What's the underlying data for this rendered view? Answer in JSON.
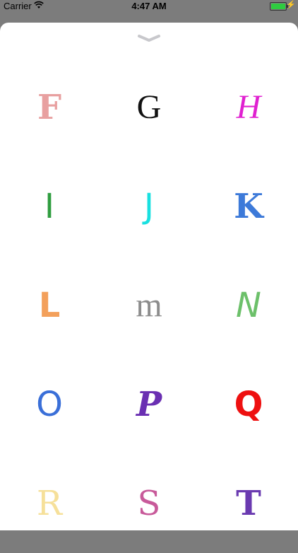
{
  "status": {
    "carrier": "Carrier",
    "time": "4:47 AM"
  },
  "sheet": {
    "close_icon": "chevron-down-icon"
  },
  "letters": [
    {
      "char": "F",
      "color": "#e8a0a0",
      "font": "serif",
      "weight": "bold",
      "style": "normal"
    },
    {
      "char": "G",
      "color": "#111111",
      "font": "cursive",
      "weight": "normal",
      "style": "normal"
    },
    {
      "char": "H",
      "color": "#e020d0",
      "font": "cursive",
      "weight": "normal",
      "style": "italic"
    },
    {
      "char": "I",
      "color": "#2f9d3f",
      "font": "sans",
      "weight": "normal",
      "style": "normal"
    },
    {
      "char": "J",
      "color": "#18e0e0",
      "font": "sans",
      "weight": "normal",
      "style": "normal"
    },
    {
      "char": "K",
      "color": "#3d7ad9",
      "font": "serif",
      "weight": "bold",
      "style": "normal"
    },
    {
      "char": "L",
      "color": "#f3a05b",
      "font": "sans",
      "weight": "bold",
      "style": "normal"
    },
    {
      "char": "m",
      "color": "#8d8d8d",
      "font": "cursive",
      "weight": "normal",
      "style": "normal"
    },
    {
      "char": "N",
      "color": "#6cc06a",
      "font": "sans",
      "weight": "normal",
      "style": "italic"
    },
    {
      "char": "O",
      "color": "#3a6fd8",
      "font": "sans",
      "weight": "normal",
      "style": "normal"
    },
    {
      "char": "P",
      "color": "#6a2fb2",
      "font": "serif",
      "weight": "bold",
      "style": "italic"
    },
    {
      "char": "Q",
      "color": "#ee1010",
      "font": "sans",
      "weight": "bold",
      "style": "normal"
    },
    {
      "char": "R",
      "color": "#f6e09a",
      "font": "serif",
      "weight": "normal",
      "style": "normal"
    },
    {
      "char": "S",
      "color": "#c85a9a",
      "font": "serif",
      "weight": "normal",
      "style": "normal"
    },
    {
      "char": "T",
      "color": "#6a3ab0",
      "font": "serif",
      "weight": "bold",
      "style": "normal"
    }
  ]
}
